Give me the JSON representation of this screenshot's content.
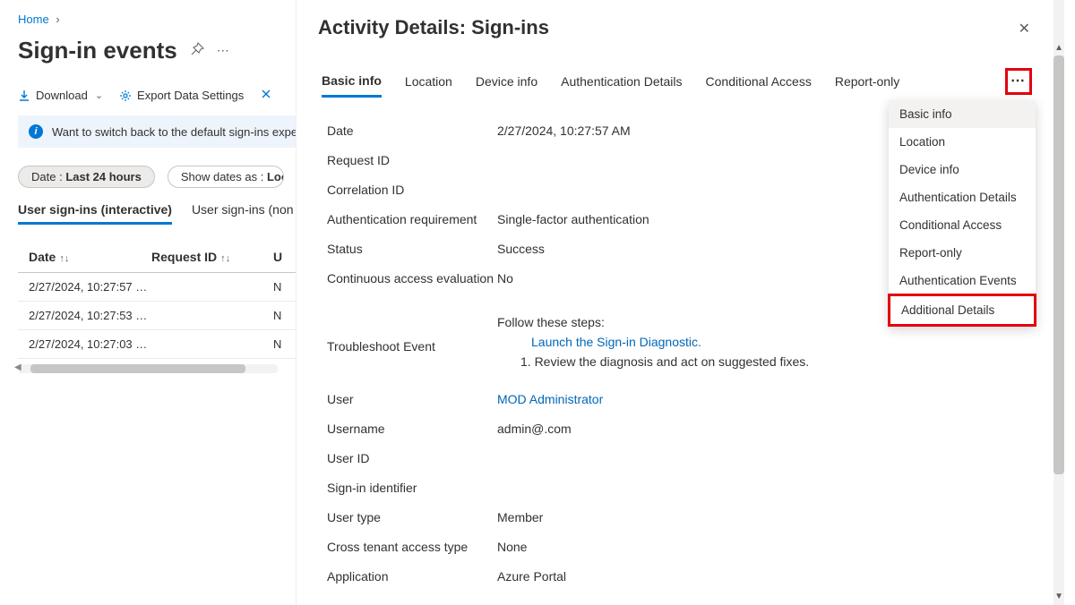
{
  "breadcrumb": {
    "home": "Home"
  },
  "page_title": "Sign-in events",
  "toolbar": {
    "download": "Download",
    "export": "Export Data Settings"
  },
  "banner": "Want to switch back to the default sign-ins experi",
  "filters": {
    "date_label": "Date :",
    "date_value": "Last 24 hours",
    "show_label": "Show dates as :",
    "show_value": "Loca"
  },
  "left_tabs": {
    "t1": "User sign-ins (interactive)",
    "t2": "User sign-ins (non"
  },
  "columns": {
    "c1": "Date",
    "c2": "Request ID",
    "c3": "U"
  },
  "rows": [
    {
      "date": "2/27/2024, 10:27:57 …",
      "req": "",
      "u": "N"
    },
    {
      "date": "2/27/2024, 10:27:53 …",
      "req": "",
      "u": "N"
    },
    {
      "date": "2/27/2024, 10:27:03 …",
      "req": "",
      "u": "N"
    }
  ],
  "panel_title": "Activity Details: Sign-ins",
  "ptabs": {
    "basic": "Basic info",
    "location": "Location",
    "device": "Device info",
    "auth": "Authentication Details",
    "ca": "Conditional Access",
    "report": "Report-only"
  },
  "menu": {
    "m1": "Basic info",
    "m2": "Location",
    "m3": "Device info",
    "m4": "Authentication Details",
    "m5": "Conditional Access",
    "m6": "Report-only",
    "m7": "Authentication Events",
    "m8": "Additional Details"
  },
  "details": {
    "date_l": "Date",
    "date_v": "2/27/2024, 10:27:57 AM",
    "req_l": "Request ID",
    "req_v": "",
    "corr_l": "Correlation ID",
    "corr_v": "",
    "authreq_l": "Authentication requirement",
    "authreq_v": "Single-factor authentication",
    "status_l": "Status",
    "status_v": "Success",
    "cae_l": "Continuous access evaluation",
    "cae_v": "No",
    "trouble_l": "Troubleshoot Event",
    "follow": "Follow these steps:",
    "launch": "Launch the Sign-in Diagnostic.",
    "step1": "1. Review the diagnosis and act on suggested fixes.",
    "user_l": "User",
    "user_v": "MOD Administrator",
    "username_l": "Username",
    "username_v": "admin@.com",
    "userid_l": "User ID",
    "userid_v": "",
    "signid_l": "Sign-in identifier",
    "signid_v": "",
    "usertype_l": "User type",
    "usertype_v": "Member",
    "cross_l": "Cross tenant access type",
    "cross_v": "None",
    "app_l": "Application",
    "app_v": "Azure Portal"
  }
}
